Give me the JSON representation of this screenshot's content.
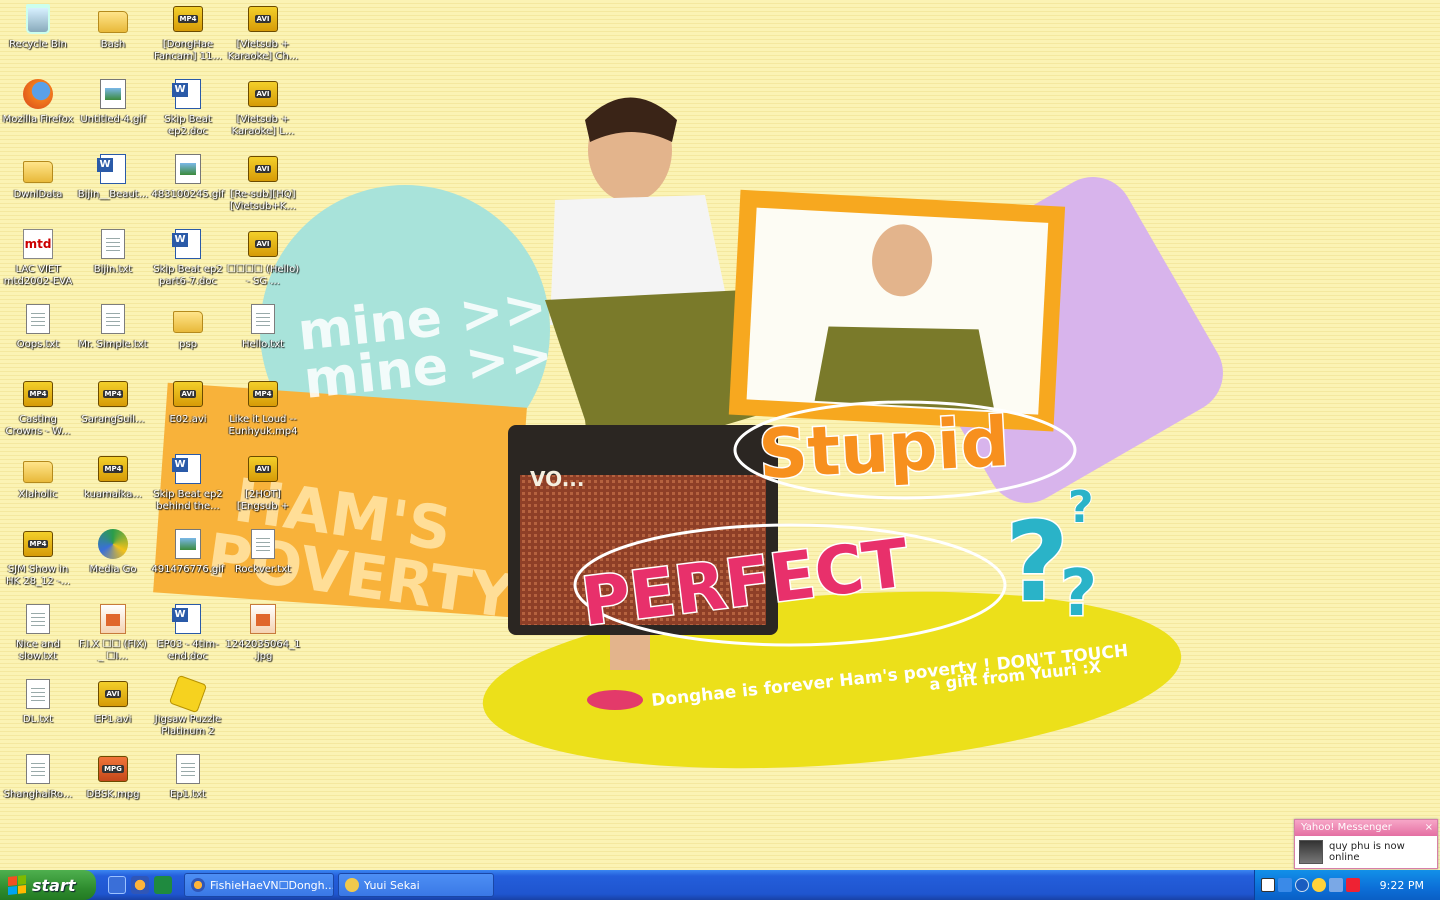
{
  "wallpaper": {
    "mine_1": "mine >>",
    "mine_2": "mine >>",
    "hams": "HAM'S",
    "poverty": "POVERTY",
    "stupid": "Stupid",
    "perfect": "PERFECT",
    "qmark": "?",
    "tagline": "Donghae is forever Ham's poverty ! DON'T TOUCH",
    "gift": "a gift from Yuuri :X",
    "amp_brand": "VO..."
  },
  "icons": [
    {
      "label": "Recycle Bin",
      "type": "recycle"
    },
    {
      "label": "Mozilla Firefox",
      "type": "firefox"
    },
    {
      "label": "DwnlData",
      "type": "folder"
    },
    {
      "label": "LAC VIET mtd2002-EVA",
      "type": "app"
    },
    {
      "label": "Oops.txt",
      "type": "doc"
    },
    {
      "label": "Casting Crowns - W...",
      "type": "mp4"
    },
    {
      "label": "Xlaholic",
      "type": "folder"
    },
    {
      "label": "SJM Show in HK 28_12 -...",
      "type": "mp4"
    },
    {
      "label": "Nice and slow.txt",
      "type": "doc"
    },
    {
      "label": "DL.txt",
      "type": "doc"
    },
    {
      "label": "ShanghaiRo...",
      "type": "doc"
    },
    {
      "label": "Bash",
      "type": "folder"
    },
    {
      "label": "Untitled-4.gif",
      "type": "image"
    },
    {
      "label": "Bijin__Beaut...",
      "type": "word"
    },
    {
      "label": "Bijin.txt",
      "type": "doc"
    },
    {
      "label": "Mr. Simple.txt",
      "type": "doc"
    },
    {
      "label": "SarangSuil...",
      "type": "mp4"
    },
    {
      "label": "kuamaika...",
      "type": "mp4"
    },
    {
      "label": "Media Go",
      "type": "mediago"
    },
    {
      "label": "F.I.X ☐☐ (FIX) _ ☐I...",
      "type": "orange"
    },
    {
      "label": "EP1.avi",
      "type": "avi"
    },
    {
      "label": "DBSK.mpg",
      "type": "mpg"
    },
    {
      "label": "[DongHae Fancam] 11...",
      "type": "mp4"
    },
    {
      "label": "Skip Beat ep2.doc",
      "type": "word"
    },
    {
      "label": "483100245.gif",
      "type": "image"
    },
    {
      "label": "Skip Beat ep2 part6-7.doc",
      "type": "word"
    },
    {
      "label": "psp",
      "type": "folder"
    },
    {
      "label": "E02.avi",
      "type": "avi"
    },
    {
      "label": "Skip Beat ep2 behind the...",
      "type": "word"
    },
    {
      "label": "491476776.gif",
      "type": "image"
    },
    {
      "label": "EP03 - 4tim-end.doc",
      "type": "word"
    },
    {
      "label": "Jigsaw Puzzle Platinum 2",
      "type": "puzzle"
    },
    {
      "label": "Ep1.txt",
      "type": "doc"
    },
    {
      "label": "[Vietsub + Karaoke] Ch...",
      "type": "avi"
    },
    {
      "label": "[Vietsub + Karaoke] L...",
      "type": "avi"
    },
    {
      "label": "[Re-sub][HQ][Vietsub+K...",
      "type": "avi"
    },
    {
      "label": "☐☐☐☐ (Hello) - SG ...",
      "type": "avi"
    },
    {
      "label": "Hello.txt",
      "type": "doc"
    },
    {
      "label": "Like it Loud -- Eunhyuk.mp4",
      "type": "mp4"
    },
    {
      "label": "[2HOT][Engsub + Karaoke] ...",
      "type": "avi"
    },
    {
      "label": "Rockver.txt",
      "type": "doc"
    },
    {
      "label": "1242035064_1.jpg",
      "type": "orange"
    }
  ],
  "taskbar": {
    "start_label": "start",
    "buttons": [
      {
        "label": "FishieHaeVN☐Dongh..."
      },
      {
        "label": "Yuui Sekai"
      }
    ],
    "clock": "9:22 PM"
  },
  "yahoo": {
    "title": "Yahoo! Messenger",
    "close": "×",
    "message": "quy phu is now online"
  },
  "colors": {
    "wallpaper_bg": "#fbf3b4",
    "teal": "#a8e3da",
    "purple": "#d8b4ec",
    "orange": "#f7a81f",
    "pink": "#e8306b",
    "yellow": "#ece01a"
  }
}
